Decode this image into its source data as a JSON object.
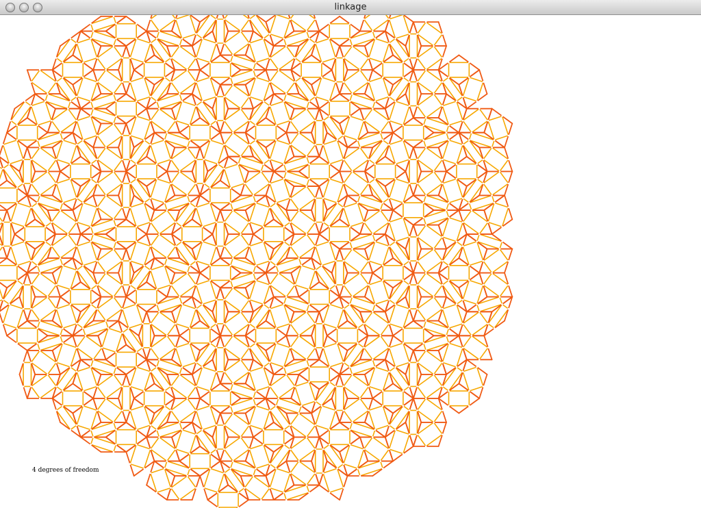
{
  "window": {
    "title": "linkage"
  },
  "status": {
    "text": "4 degrees of freedom"
  },
  "colors": {
    "background": "#ffffff",
    "outer_bars": "#f05a14",
    "inner_bars": "#f7a800",
    "joints": "#ffffff"
  },
  "canvas": {
    "figure": "Penrose-tiling linkage"
  }
}
